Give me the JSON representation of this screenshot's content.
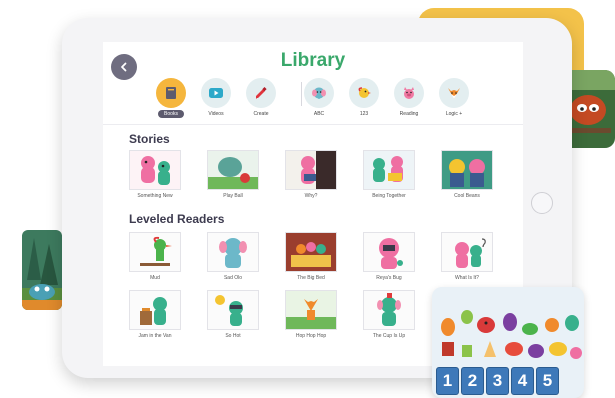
{
  "library": {
    "title": "Library",
    "tabs": [
      {
        "label": "Books",
        "color": "#f5b63d",
        "active": true
      },
      {
        "label": "Videos",
        "color": "#e6f1ee",
        "active": false
      },
      {
        "label": "Create",
        "color": "#e6f1ee",
        "active": false
      },
      {
        "label": "ABC",
        "color": "#e6f1ee",
        "active": false
      },
      {
        "label": "123",
        "color": "#e6f1ee",
        "active": false
      },
      {
        "label": "Reading",
        "color": "#e6f1ee",
        "active": false
      },
      {
        "label": "Logic +",
        "color": "#e6f1ee",
        "active": false
      }
    ],
    "sections": [
      {
        "name": "Stories",
        "books": [
          "Something New",
          "Play Ball",
          "Why?",
          "Being Together",
          "Cool Beans"
        ]
      },
      {
        "name": "Leveled Readers",
        "books": [
          "Mud",
          "Sad Olo",
          "The Big Bed",
          "Reya's Bug",
          "What Is It?",
          "Jam in the Van",
          "So Hot",
          "Hop Hop Hop",
          "The Cup Is Up"
        ]
      }
    ]
  },
  "puzzle": {
    "numbers": [
      "1",
      "2",
      "3",
      "4",
      "5"
    ]
  },
  "colors": {
    "title_green": "#3aa86b",
    "accent_yellow": "#f3c24a",
    "number_blue": "#3e79b9"
  }
}
